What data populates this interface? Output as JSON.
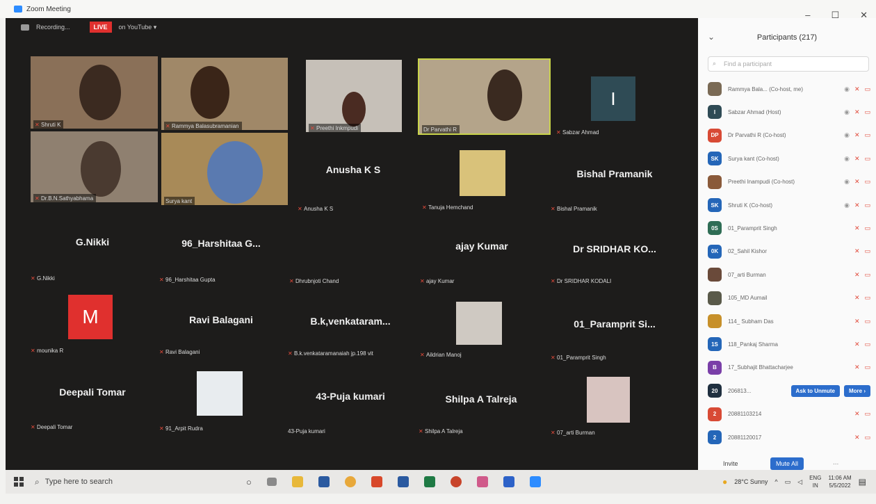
{
  "window": {
    "title": "Zoom Meeting",
    "controls": [
      "–",
      "☐",
      "✕"
    ]
  },
  "topbar": {
    "recording": "Recording...",
    "live": "LIVE",
    "live_target": "on YouTube ▾"
  },
  "tiles": [
    {
      "name": "Shruti K",
      "type": "video"
    },
    {
      "name": "Rammya Balasubramanian",
      "type": "video"
    },
    {
      "name": "Preethi Inkmpudi",
      "type": "video"
    },
    {
      "name": "Dr Parvathi R",
      "type": "video",
      "active": true
    },
    {
      "name": "Sabzar Ahmad",
      "type": "avatar",
      "initial": "I"
    },
    {
      "name": "Dr.B.N.Sathyabhama",
      "type": "video"
    },
    {
      "name": "Surya kant",
      "type": "video"
    },
    {
      "name": "Anusha K S",
      "center": "Anusha K S",
      "type": "name"
    },
    {
      "name": "Tanuja Hemchand",
      "type": "photo"
    },
    {
      "name": "Bishal Pramanik",
      "center": "Bishal Pramanik",
      "type": "name"
    },
    {
      "name": "G.Nikki",
      "center": "G.Nikki",
      "type": "name"
    },
    {
      "name": "96_Harshitaa Gupta",
      "center": "96_Harshitaa G...",
      "type": "name"
    },
    {
      "name": "Dhrubnjoti Chand",
      "type": "name"
    },
    {
      "name": "ajay Kumar",
      "center": "ajay Kumar",
      "type": "name"
    },
    {
      "name": "Dr SRIDHAR KODALI",
      "center": "Dr SRIDHAR KO...",
      "type": "name"
    },
    {
      "name": "mounika R",
      "type": "avatar",
      "initial": "M"
    },
    {
      "name": "Ravi Balagani",
      "center": "Ravi Balagani",
      "type": "name"
    },
    {
      "name": "B.k.venkataramanaiah jp.198 vit",
      "center": "B.k,venkataram...",
      "type": "name"
    },
    {
      "name": "Aildrian Manoj",
      "type": "photo"
    },
    {
      "name": "01_Paramprit Singh",
      "center": "01_Paramprit Si...",
      "type": "name"
    },
    {
      "name": "Deepali Tomar",
      "center": "Deepali Tomar",
      "type": "name"
    },
    {
      "name": "91_Arpit Rudra",
      "type": "photo"
    },
    {
      "name": "43-Puja kumari",
      "center": "43-Puja kumari",
      "type": "name"
    },
    {
      "name": "Shilpa A Talreja",
      "center": "Shilpa A Talreja",
      "type": "name"
    },
    {
      "name": "07_arti Burman",
      "type": "photo"
    }
  ],
  "panel": {
    "title": "Participants (217)",
    "search_placeholder": "Find a participant",
    "participants": [
      {
        "initials": "",
        "name": "Rammya Bala... (Co-host, me)",
        "color": "#7a6a55"
      },
      {
        "initials": "I",
        "name": "Sabzar Ahmad (Host)",
        "color": "#2f4b55"
      },
      {
        "initials": "DP",
        "name": "Dr Parvathi R (Co-host)",
        "color": "#d84a35"
      },
      {
        "initials": "SK",
        "name": "Surya kant (Co-host)",
        "color": "#2466b8"
      },
      {
        "initials": "",
        "name": "Preethi Inampudi (Co-host)",
        "color": "#8a5a3a"
      },
      {
        "initials": "SK",
        "name": "Shruti K (Co-host)",
        "color": "#2466b8"
      },
      {
        "initials": "0S",
        "name": "01_Paramprit Singh",
        "color": "#2f6d55"
      },
      {
        "initials": "0K",
        "name": "02_Sahil Kishor",
        "color": "#2466b8"
      },
      {
        "initials": "",
        "name": "07_arti Burman",
        "color": "#6a4a3a"
      },
      {
        "initials": "",
        "name": "105_MD Aumail",
        "color": "#5a5a4a"
      },
      {
        "initials": "",
        "name": "114_ Subham Das",
        "color": "#c7902a"
      },
      {
        "initials": "1S",
        "name": "118_Pankaj Sharma",
        "color": "#2466b8"
      },
      {
        "initials": "B",
        "name": "17_Subhajit Bhattacharjee",
        "color": "#7a3fa8"
      },
      {
        "initials": "20",
        "name": "206813...",
        "color": "#1f2f3f"
      },
      {
        "initials": "2",
        "name": "20881103214",
        "color": "#d84a35"
      },
      {
        "initials": "2",
        "name": "20881120017",
        "color": "#2466b8"
      }
    ],
    "ask_unmute": "Ask to Unmute",
    "more": "More ›",
    "invite": "Invite",
    "mute_all": "Mute All",
    "more_dots": "..."
  },
  "taskbar": {
    "search_placeholder": "Type here to search",
    "weather": "28°C  Sunny",
    "lang": "ENG",
    "region": "IN",
    "time": "11:06 AM",
    "date": "5/5/2022"
  }
}
